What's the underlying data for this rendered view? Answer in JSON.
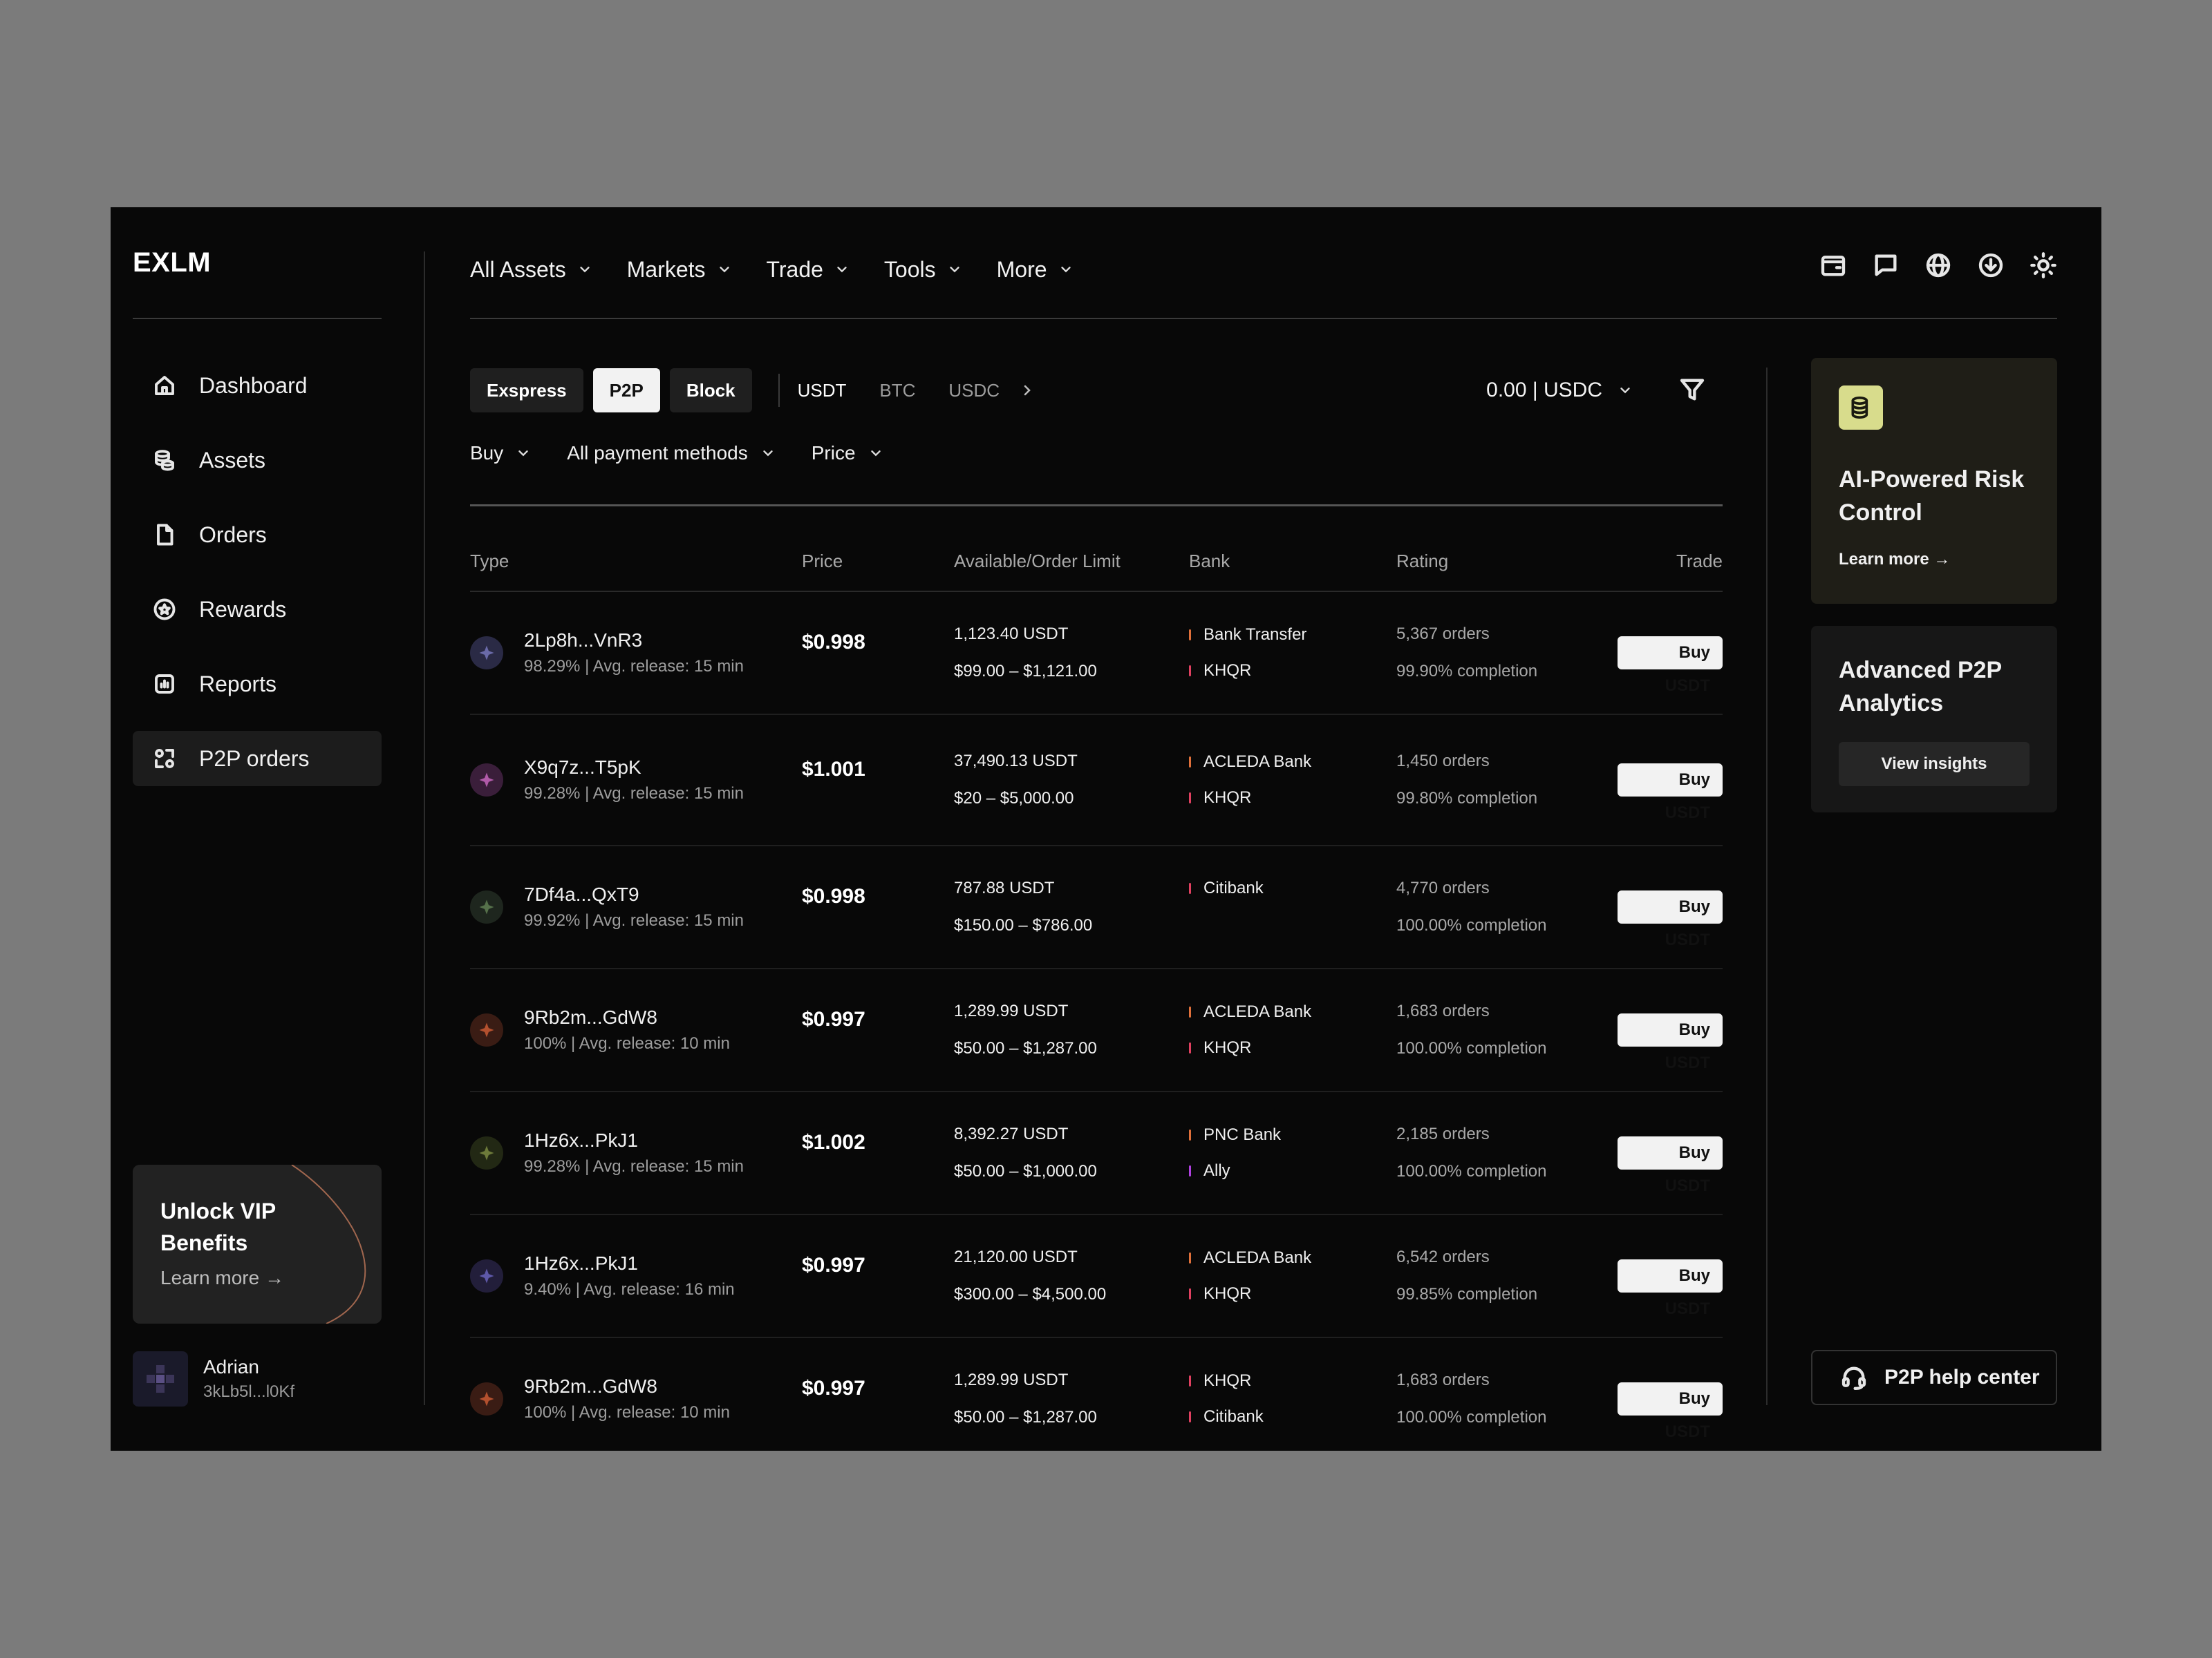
{
  "app": {
    "logo": "EXLM"
  },
  "sidebar": {
    "items": [
      {
        "label": "Dashboard",
        "icon": "home-icon"
      },
      {
        "label": "Assets",
        "icon": "coins-icon"
      },
      {
        "label": "Orders",
        "icon": "document-icon"
      },
      {
        "label": "Rewards",
        "icon": "badge-icon"
      },
      {
        "label": "Reports",
        "icon": "chart-icon"
      },
      {
        "label": "P2P orders",
        "icon": "p2p-icon",
        "active": true
      }
    ],
    "vip": {
      "title": "Unlock VIP Benefits",
      "link": "Learn more →"
    },
    "user": {
      "name": "Adrian",
      "id": "3kLb5l...l0Kf"
    }
  },
  "topnav": {
    "items": [
      "All Assets",
      "Markets",
      "Trade",
      "Tools",
      "More"
    ],
    "icons": [
      "wallet-icon",
      "chat-icon",
      "globe-icon",
      "download-icon",
      "sun-icon"
    ]
  },
  "toolbar": {
    "modes": [
      "Exspress",
      "P2P",
      "Block"
    ],
    "active_mode": "P2P",
    "coins": [
      "USDT",
      "BTC",
      "USDC"
    ],
    "active_coin": "USDT",
    "balance": "0.00 | USDC"
  },
  "filters": [
    "Buy",
    "All payment methods",
    "Price"
  ],
  "table": {
    "headers": {
      "type": "Type",
      "price": "Price",
      "avail": "Available/Order Limit",
      "bank": "Bank",
      "rating": "Rating",
      "trade": "Trade"
    },
    "rows": [
      {
        "merchant": "2Lp8h...VnR3",
        "sub": "98.29% | Avg. release: 15 min",
        "price": "$0.998",
        "available": "1,123.40 USDT",
        "limit": "$99.00 – $1,121.00",
        "banks": [
          "Bank Transfer",
          "KHQR"
        ],
        "orders": "5,367 orders",
        "completion": "99.90% completion",
        "action": "Buy USDT",
        "icon_color": "#2a2a45",
        "icon_fg": "#6a6aa8"
      },
      {
        "merchant": "X9q7z...T5pK",
        "sub": "99.28% | Avg. release: 15 min",
        "price": "$1.001",
        "available": "37,490.13 USDT",
        "limit": "$20 – $5,000.00",
        "banks": [
          "ACLEDA Bank",
          "KHQR"
        ],
        "orders": "1,450 orders",
        "completion": "99.80% completion",
        "action": "Buy USDT",
        "icon_color": "#3a1e3a",
        "icon_fg": "#b05aa8"
      },
      {
        "merchant": "7Df4a...QxT9",
        "sub": "99.92% | Avg. release: 15 min",
        "price": "$0.998",
        "available": "787.88 USDT",
        "limit": "$150.00 – $786.00",
        "banks": [
          "Citibank"
        ],
        "orders": "4,770 orders",
        "completion": "100.00% completion",
        "action": "Buy USDT",
        "icon_color": "#1e261e",
        "icon_fg": "#55704a"
      },
      {
        "merchant": "9Rb2m...GdW8",
        "sub": "100% | Avg. release: 10 min",
        "price": "$0.997",
        "available": "1,289.99 USDT",
        "limit": "$50.00 – $1,287.00",
        "banks": [
          "ACLEDA Bank",
          "KHQR"
        ],
        "orders": "1,683 orders",
        "completion": "100.00% completion",
        "action": "Buy USDT",
        "icon_color": "#3a1c14",
        "icon_fg": "#b3502e"
      },
      {
        "merchant": "1Hz6x...PkJ1",
        "sub": "99.28% | Avg. release: 15 min",
        "price": "$1.002",
        "available": "8,392.27 USDT",
        "limit": "$50.00 – $1,000.00",
        "banks": [
          "PNC Bank",
          "Ally"
        ],
        "orders": "2,185 orders",
        "completion": "100.00% completion",
        "action": "Buy USDT",
        "icon_color": "#222814",
        "icon_fg": "#6d7a3a"
      },
      {
        "merchant": "1Hz6x...PkJ1",
        "sub": "9.40% | Avg. release: 16 min",
        "price": "$0.997",
        "available": "21,120.00 USDT",
        "limit": "$300.00 – $4,500.00",
        "banks": [
          "ACLEDA Bank",
          "KHQR"
        ],
        "orders": "6,542 orders",
        "completion": "99.85% completion",
        "action": "Buy USDT",
        "icon_color": "#221e3a",
        "icon_fg": "#5e58a8"
      },
      {
        "merchant": "9Rb2m...GdW8",
        "sub": "100% | Avg. release: 10 min",
        "price": "$0.997",
        "available": "1,289.99 USDT",
        "limit": "$50.00 – $1,287.00",
        "banks": [
          "KHQR",
          "Citibank"
        ],
        "orders": "1,683 orders",
        "completion": "100.00% completion",
        "action": "Buy USDT",
        "icon_color": "#3a1c14",
        "icon_fg": "#b3502e"
      }
    ]
  },
  "bank_colors": {
    "Bank Transfer": "#e0703a",
    "KHQR": "#e04060",
    "ACLEDA Bank": "#e0703a",
    "Citibank": "#e04060",
    "PNC Bank": "#e0703a",
    "Ally": "#b040e0"
  },
  "cards": {
    "risk": {
      "title": "AI-Powered Risk Control",
      "link": "Learn more →",
      "icon": "coins-icon"
    },
    "analytics": {
      "title": "Advanced P2P Analytics",
      "button": "View insights"
    },
    "help": {
      "label": "P2P help center",
      "icon": "headset-icon"
    }
  }
}
